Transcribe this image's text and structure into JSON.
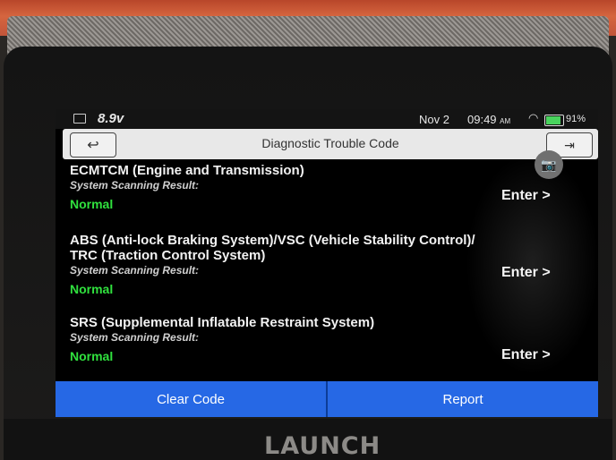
{
  "device": {
    "brand": "LAUNCH"
  },
  "status_bar": {
    "voltage": "8.9v",
    "date": "Nov 2",
    "time": "09:49",
    "time_suffix": "AM",
    "battery_pct": "91%"
  },
  "header": {
    "title": "Diagnostic Trouble Code",
    "back_icon": "back-arrow-icon",
    "exit_icon": "exit-icon",
    "camera_icon": "camera-icon"
  },
  "systems": [
    {
      "name": "ECMTCM (Engine and Transmission)",
      "scan_label": "System Scanning Result:",
      "status": "Normal",
      "enter_label": "Enter >"
    },
    {
      "name": "ABS (Anti-lock Braking System)/VSC (Vehicle Stability Control)/ TRC (Traction Control System)",
      "scan_label": "System Scanning Result:",
      "status": "Normal",
      "enter_label": "Enter >"
    },
    {
      "name": "SRS (Supplemental Inflatable Restraint System)",
      "scan_label": "System Scanning Result:",
      "status": "Normal",
      "enter_label": "Enter >"
    }
  ],
  "bottom_bar": {
    "clear_code": "Clear Code",
    "report": "Report"
  },
  "colors": {
    "status_normal": "#30e13e",
    "bottom_bar": "#2668e5"
  }
}
